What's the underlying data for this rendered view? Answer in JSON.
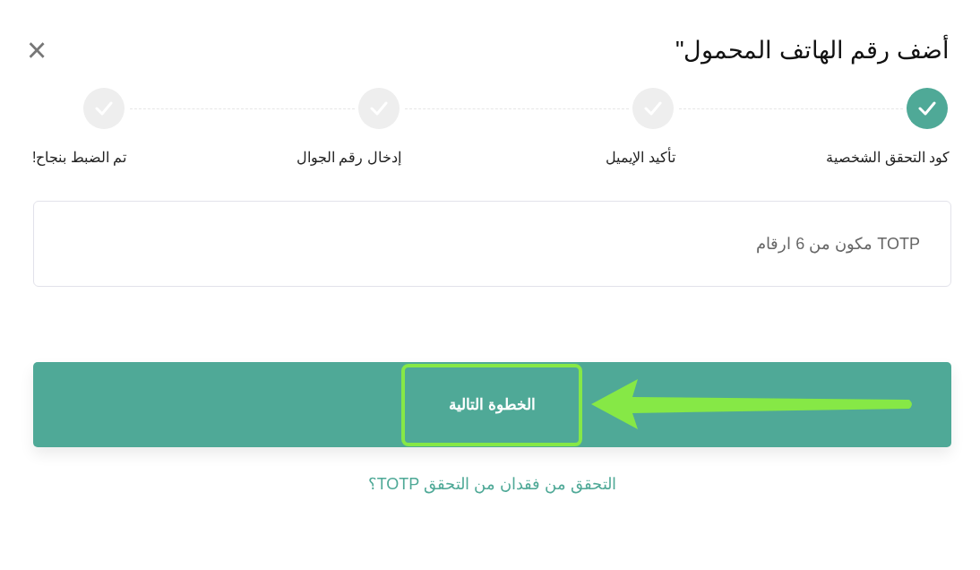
{
  "dialog": {
    "title": "أضف رقم الهاتف المحمول\"",
    "close": "×"
  },
  "steps": [
    {
      "label": "كود التحقق الشخصية",
      "completed": true
    },
    {
      "label": "تأكيد الإيميل",
      "completed": false
    },
    {
      "label": "إدخال رقم الجوال",
      "completed": false
    },
    {
      "label": "تم الضبط بنجاح!",
      "completed": false
    }
  ],
  "field": {
    "placeholder": "TOTP مكون من 6 ارقام"
  },
  "button": {
    "label": "الخطوة التالية"
  },
  "link": "التحقق من فقدان من التحقق TOTP؟"
}
